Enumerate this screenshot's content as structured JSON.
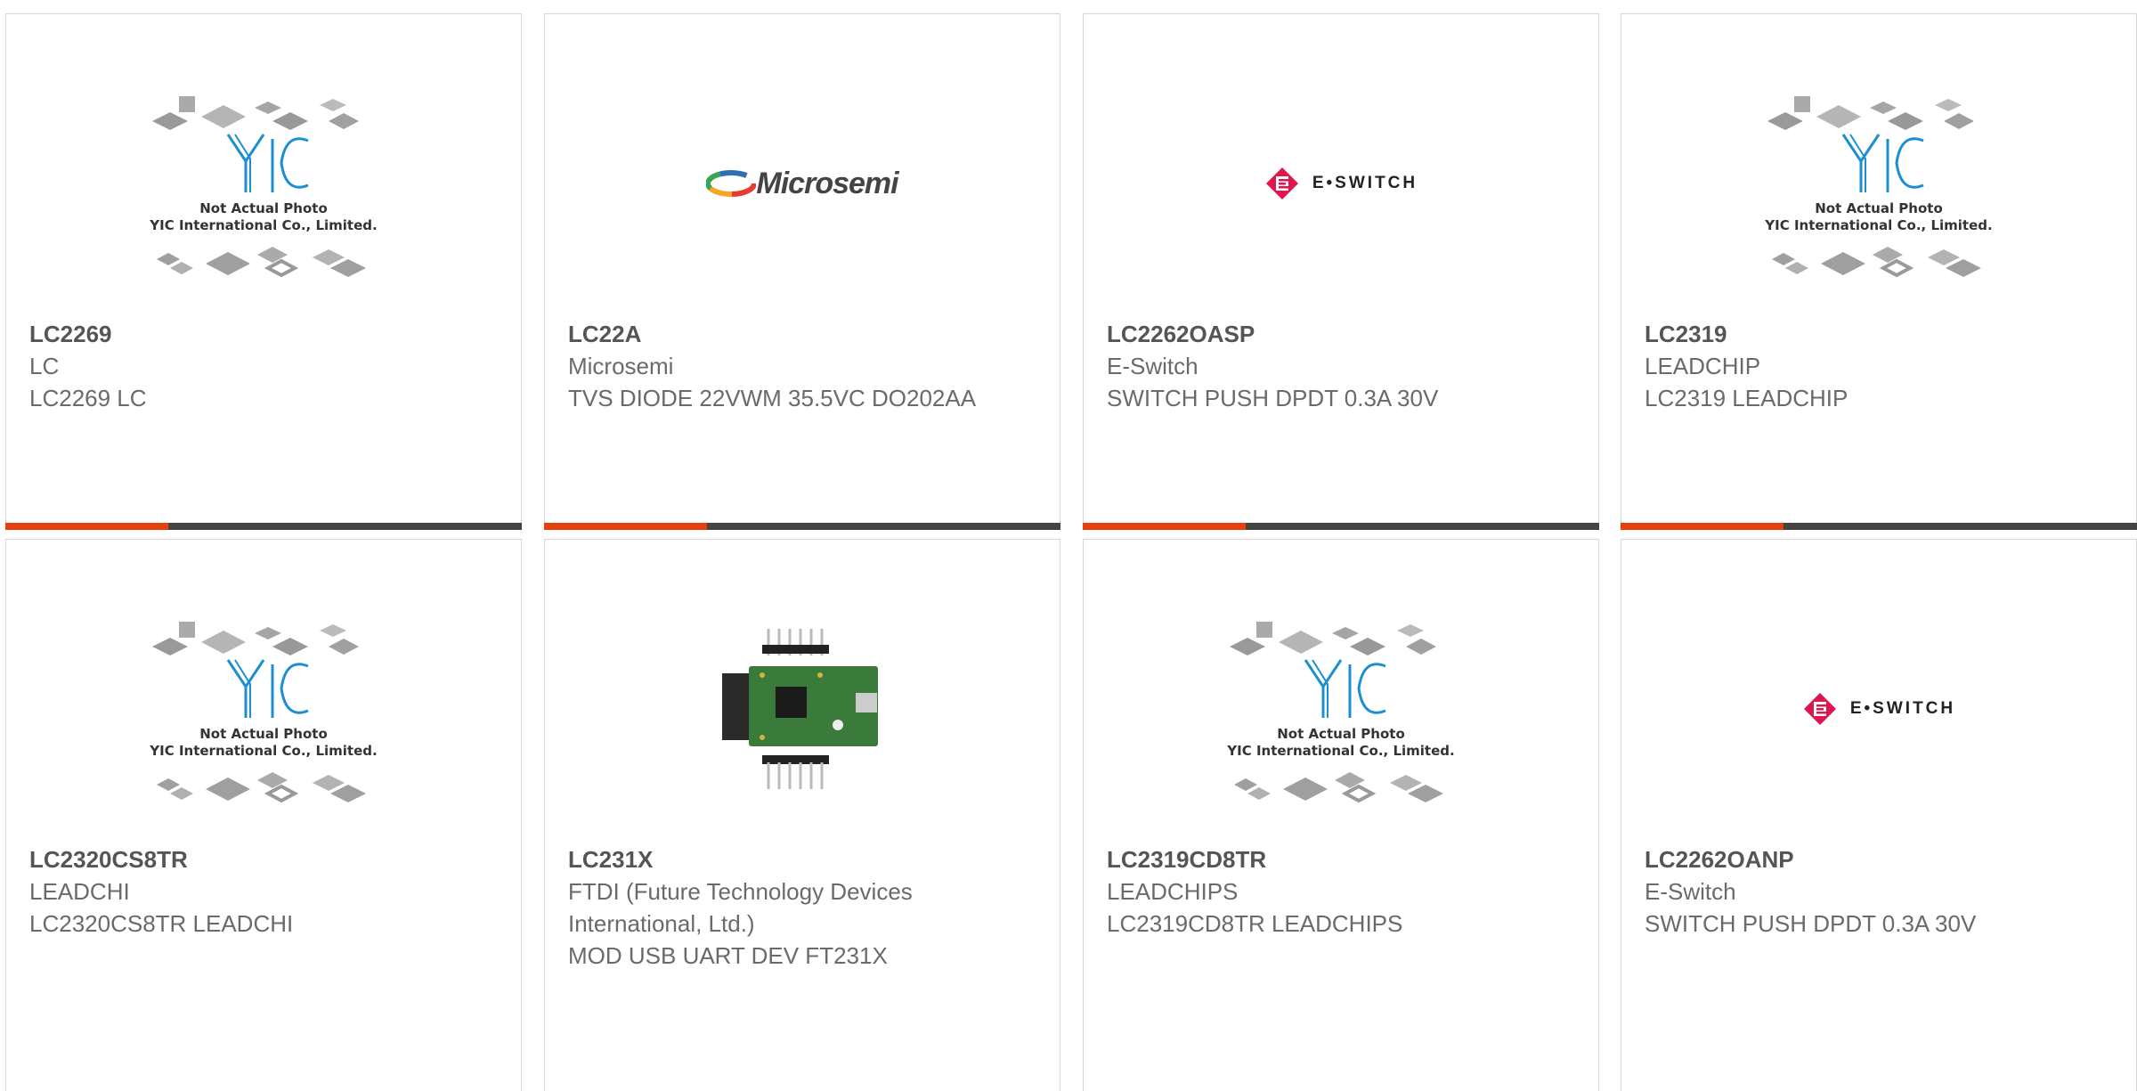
{
  "products": [
    {
      "part_number": "LC2269",
      "manufacturer": "LC",
      "description": "LC2269 LC",
      "image": "yic-placeholder"
    },
    {
      "part_number": "LC22A",
      "manufacturer": "Microsemi",
      "description": "TVS DIODE 22VWM 35.5VC DO202AA",
      "image": "microsemi-logo",
      "logo_text": "Microsemi"
    },
    {
      "part_number": "LC2262OASP",
      "manufacturer": "E-Switch",
      "description": "SWITCH PUSH DPDT 0.3A 30V",
      "image": "eswitch-logo",
      "logo_text": "E•SWITCH"
    },
    {
      "part_number": "LC2319",
      "manufacturer": "LEADCHIP",
      "description": "LC2319 LEADCHIP",
      "image": "yic-placeholder"
    },
    {
      "part_number": "LC2320CS8TR",
      "manufacturer": "LEADCHI",
      "description": "LC2320CS8TR LEADCHI",
      "image": "yic-placeholder"
    },
    {
      "part_number": "LC231X",
      "manufacturer": "FTDI (Future Technology Devices International, Ltd.)",
      "description": "MOD USB UART DEV FT231X",
      "image": "usb-module-photo"
    },
    {
      "part_number": "LC2319CD8TR",
      "manufacturer": "LEADCHIPS",
      "description": "LC2319CD8TR LEADCHIPS",
      "image": "yic-placeholder"
    },
    {
      "part_number": "LC2262OANP",
      "manufacturer": "E-Switch",
      "description": "SWITCH PUSH DPDT 0.3A 30V",
      "image": "eswitch-logo",
      "logo_text": "E•SWITCH"
    }
  ],
  "placeholder": {
    "line1": "Not Actual Photo",
    "line2": "YIC International Co., Limited."
  },
  "colors": {
    "accent": "#e8400c",
    "bar": "#444444",
    "yic_blue": "#1d8fd0",
    "eswitch_red": "#e0174f"
  }
}
